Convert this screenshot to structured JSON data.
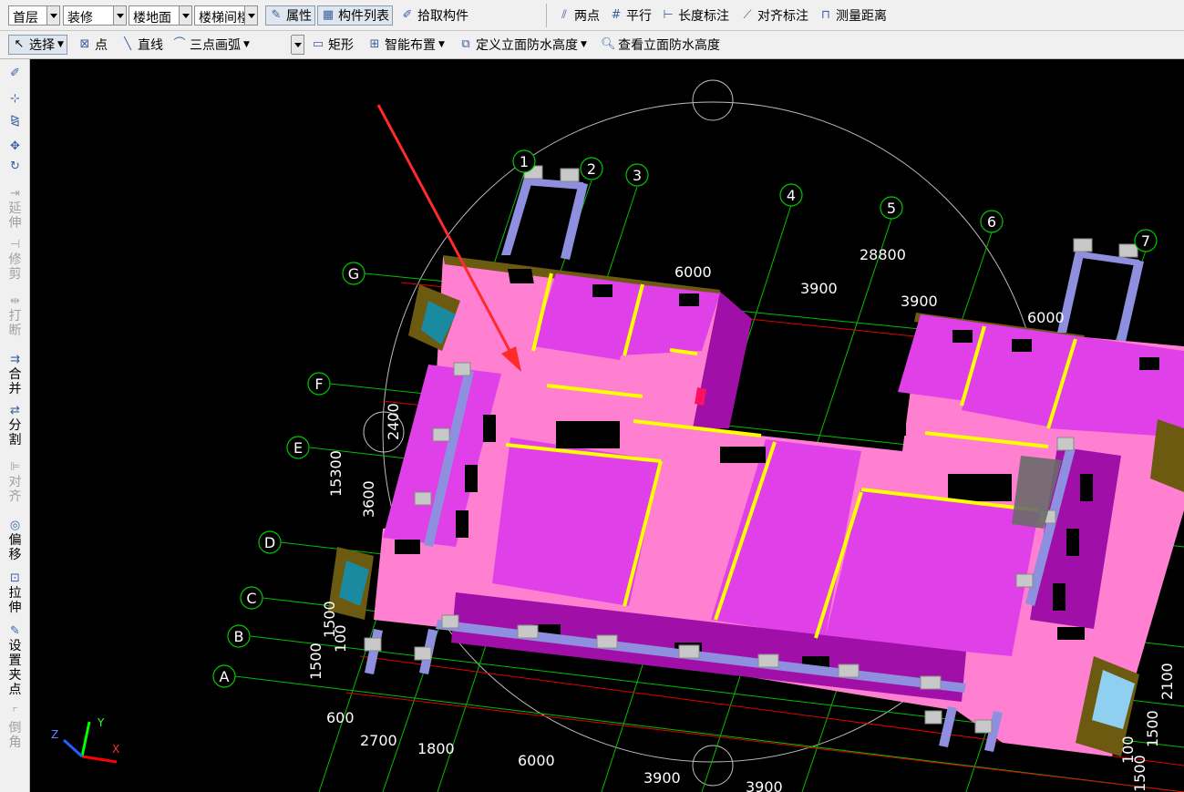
{
  "toolbar1": {
    "floor_value": "首层",
    "type_value": "装修",
    "category_value": "楼地面",
    "component_value": "楼梯间楼",
    "props_label": "属性",
    "list_label": "构件列表",
    "pick_label": "拾取构件",
    "two_point_label": "两点",
    "parallel_label": "平行",
    "length_dim_label": "长度标注",
    "align_dim_label": "对齐标注",
    "measure_label": "测量距离"
  },
  "toolbar2": {
    "select_label": "选择",
    "point_label": "点",
    "line_label": "直线",
    "arc_value": "三点画弧",
    "rect_label": "矩形",
    "smart_label": "智能布置",
    "define_label": "定义立面防水高度",
    "view_label": "查看立面防水高度"
  },
  "left_toolbar": [
    {
      "label": "",
      "icon": "brush-icon",
      "disabled": false
    },
    {
      "label": "",
      "icon": "copy-icon",
      "disabled": false
    },
    {
      "label": "",
      "icon": "mirror-icon",
      "disabled": false
    },
    {
      "label": "",
      "icon": "move-icon",
      "disabled": false
    },
    {
      "label": "",
      "icon": "rotate-icon",
      "disabled": false
    },
    {
      "label": "延伸",
      "icon": "extend-icon",
      "disabled": true
    },
    {
      "label": "修剪",
      "icon": "trim-icon",
      "disabled": true
    },
    {
      "label": "打断",
      "icon": "break-icon",
      "disabled": true
    },
    {
      "label": "合并",
      "icon": "merge-icon",
      "disabled": false
    },
    {
      "label": "分割",
      "icon": "split-icon",
      "disabled": false
    },
    {
      "label": "对齐",
      "icon": "align-icon",
      "disabled": true
    },
    {
      "label": "偏移",
      "icon": "offset-icon",
      "disabled": false
    },
    {
      "label": "拉伸",
      "icon": "stretch-icon",
      "disabled": false
    },
    {
      "label": "设置夹点",
      "icon": "grip-icon",
      "disabled": false
    },
    {
      "label": "倒角",
      "icon": "chamfer-icon",
      "disabled": true
    }
  ],
  "viewport": {
    "grid_numbers": [
      "1",
      "2",
      "3",
      "4",
      "5",
      "6",
      "7"
    ],
    "grid_letters": [
      "G",
      "F",
      "E",
      "D",
      "C",
      "B",
      "A"
    ],
    "top_dims": [
      "6000",
      "3900",
      "3900",
      "28800",
      "6000"
    ],
    "bottom_dims": [
      "600",
      "2700",
      "1800",
      "6000",
      "3900",
      "3900"
    ],
    "left_dims": [
      "2400",
      "15300",
      "3600",
      "1500",
      "1500",
      "100"
    ],
    "right_dims": [
      "2100",
      "1500",
      "100",
      "1500"
    ],
    "axis_labels": {
      "x": "X",
      "y": "Y",
      "z": "Z"
    },
    "colors": {
      "room_fill": "#ff7fd1",
      "wall_face": "#e040e8",
      "wall_dark": "#a010a8",
      "wall_top": "#6b5a10",
      "yellow_trim": "#ffff00",
      "column": "#8f8fdf",
      "grid_green": "#00c800",
      "grid_red": "#e00000",
      "arrow": "#ff2a2a"
    }
  }
}
